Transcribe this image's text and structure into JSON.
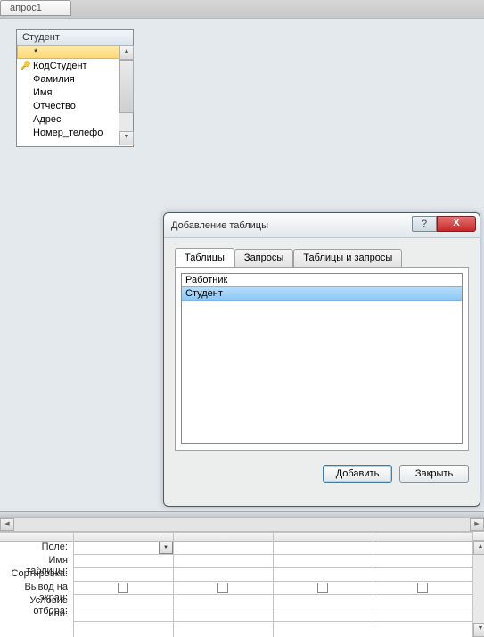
{
  "documentTab": "апрос1",
  "tableBox": {
    "title": "Студент",
    "fields": [
      "*",
      "КодСтудент",
      "Фамилия",
      "Имя",
      "Отчество",
      "Адрес",
      "Номер_телефо"
    ],
    "selectedIndex": 0,
    "keyIndex": 1
  },
  "dialog": {
    "title": "Добавление таблицы",
    "helpGlyph": "?",
    "closeGlyph": "X",
    "tabs": [
      "Таблицы",
      "Запросы",
      "Таблицы и запросы"
    ],
    "activeTab": 0,
    "items": [
      "Работник",
      "Студент"
    ],
    "selectedItem": 1,
    "addButton": "Добавить",
    "closeButton": "Закрыть"
  },
  "designGrid": {
    "rowLabels": [
      "Поле:",
      "Имя таблицы:",
      "Сортировка:",
      "Вывод на экран:",
      "Условие отбора:",
      "или:"
    ],
    "columns": 4,
    "firstHasDropdown": true,
    "checkboxRowIndex": 3
  },
  "glyphs": {
    "up": "▲",
    "down": "▼",
    "left": "◀",
    "right": "▶",
    "key": "🔑"
  }
}
